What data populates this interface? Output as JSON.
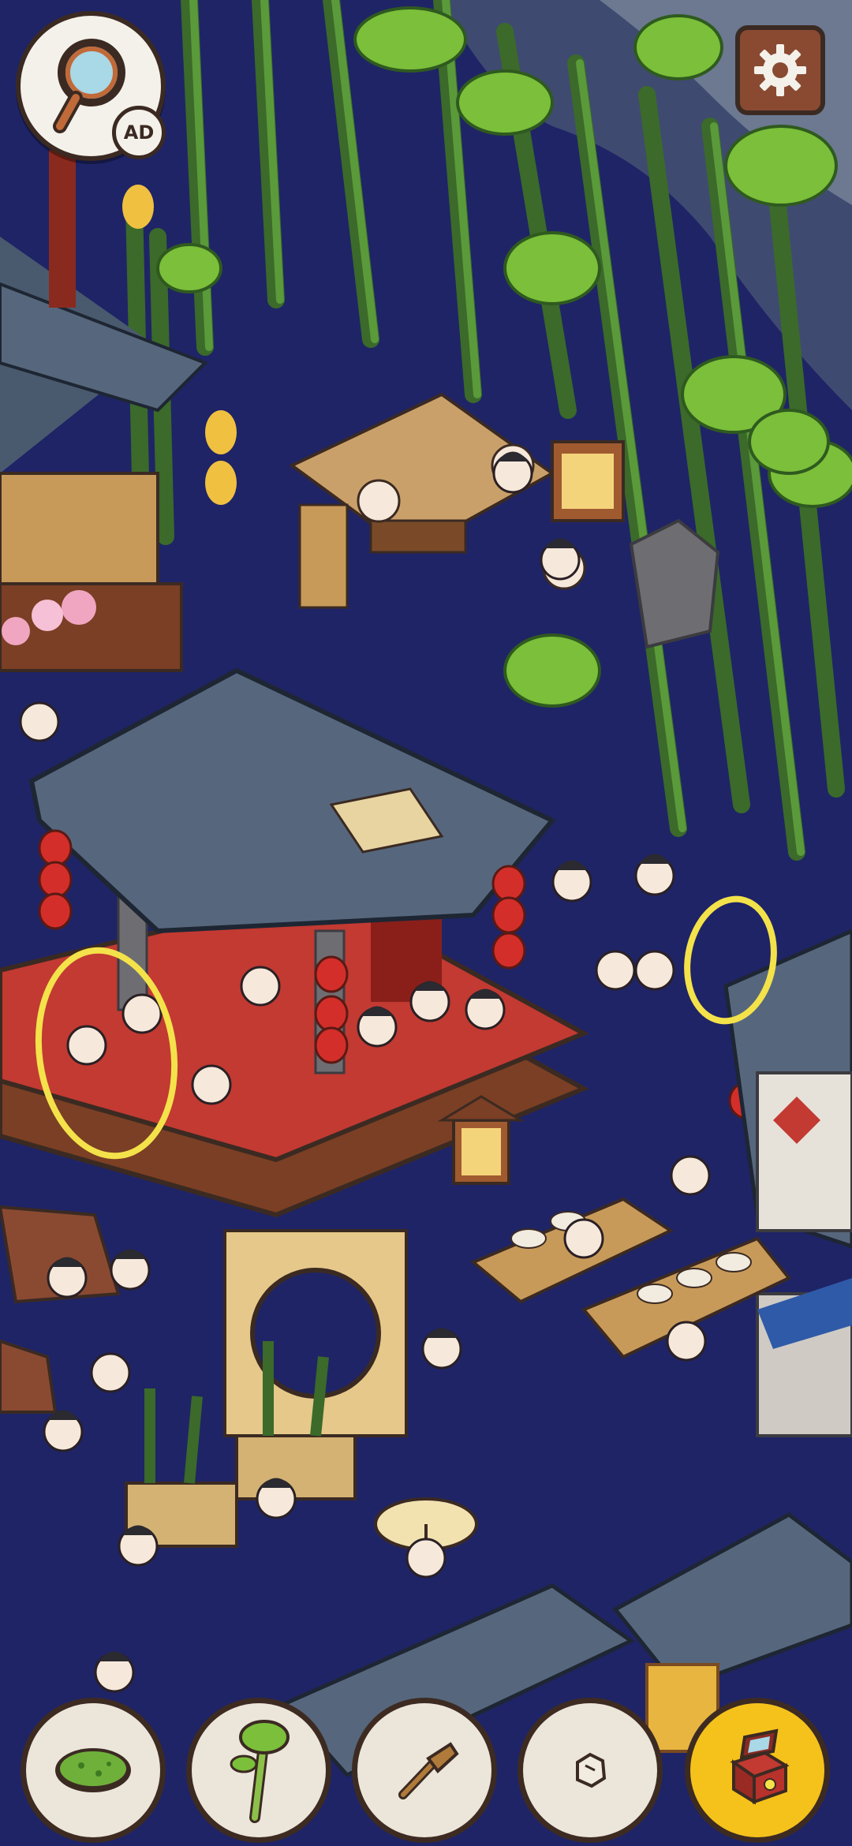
{
  "hud": {
    "hint_button": {
      "icon": "magnifier-icon",
      "badge_label": "AD"
    },
    "settings_button": {
      "icon": "gear-icon"
    }
  },
  "scene": {
    "description_icons": [
      "bamboo-grove",
      "opera-pavilion",
      "lanterns",
      "market-stalls",
      "townsfolk"
    ],
    "highlight_color": "#f4e24a",
    "found_targets": [
      "found-target-opera-performer",
      "found-target-music-box"
    ]
  },
  "item_bar": {
    "items": [
      {
        "id": "moss-plate",
        "icon": "moss-plate-icon",
        "found": false
      },
      {
        "id": "bamboo-sprig",
        "icon": "bamboo-sprig-icon",
        "found": false
      },
      {
        "id": "wooden-spatula",
        "icon": "wooden-spatula-icon",
        "found": false
      },
      {
        "id": "stone-chip",
        "icon": "stone-chip-icon",
        "found": false
      },
      {
        "id": "music-box",
        "icon": "music-box-icon",
        "found": true
      }
    ],
    "active_color": "#f5c21b",
    "slot_color": "#ece6da"
  }
}
